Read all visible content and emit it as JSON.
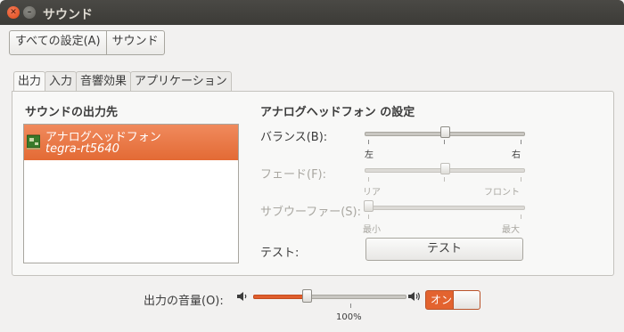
{
  "window": {
    "title": "サウンド"
  },
  "breadcrumb": {
    "items": [
      "すべての設定(A)",
      "サウンド"
    ]
  },
  "tabs": [
    {
      "label": "出力",
      "active": true
    },
    {
      "label": "入力",
      "active": false
    },
    {
      "label": "音響効果",
      "active": false
    },
    {
      "label": "アプリケーション",
      "active": false
    }
  ],
  "output": {
    "heading": "サウンドの出力先",
    "devices": [
      {
        "name": "アナログヘッドフォン",
        "detail": "tegra-rt5640",
        "selected": true,
        "icon": "sound-card-icon"
      }
    ]
  },
  "settings": {
    "heading": "アナログヘッドフォン の設定",
    "balance": {
      "label": "バランス(B):",
      "left": "左",
      "right": "右",
      "value": 0.5,
      "enabled": true
    },
    "fade": {
      "label": "フェード(F):",
      "left": "リア",
      "right": "フロント",
      "value": 0.5,
      "enabled": false
    },
    "subwoofer": {
      "label": "サブウーファー(S):",
      "left": "最小",
      "right": "最大",
      "value": 0.0,
      "enabled": false
    },
    "test": {
      "label": "テスト:",
      "button": "テスト"
    }
  },
  "volume": {
    "label": "出力の音量(O):",
    "value_percent": 35,
    "mark_label": "100%",
    "mute_toggle": {
      "label": "オン",
      "state": "on"
    },
    "icons": {
      "low": "speaker-low-icon",
      "high": "speaker-high-icon"
    }
  },
  "colors": {
    "accent": "#e3632f",
    "selection": "#e96f3c",
    "titlebar": "#3c3b37"
  }
}
